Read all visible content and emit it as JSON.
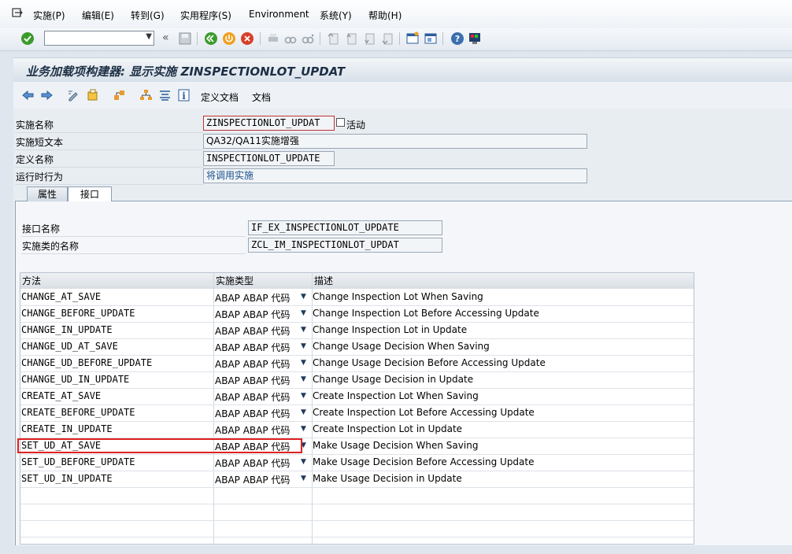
{
  "menu": {
    "items": [
      "实施(P)",
      "编辑(E)",
      "转到(G)",
      "实用程序(S)",
      "Environment",
      "系统(Y)",
      "帮助(H)"
    ]
  },
  "toolbar": {
    "command_value": "",
    "icons": [
      "check-icon",
      "back-double-icon",
      "save-icon",
      "back-icon",
      "exit-icon",
      "cancel-icon",
      "print-icon",
      "find-icon",
      "find-next-icon",
      "first-page-icon",
      "prev-page-icon",
      "next-page-icon",
      "last-page-icon",
      "new-session-icon",
      "shortcut-icon",
      "help-icon",
      "layout-icon"
    ]
  },
  "title": "业务加载项构建器: 显示实施 ZINSPECTIONLOT_UPDAT",
  "app_toolbar": {
    "define_doc": "定义文档",
    "doc": "文档"
  },
  "header_fields": {
    "impl_name_label": "实施名称",
    "impl_name_value": "ZINSPECTIONLOT_UPDAT",
    "active_label": "活动",
    "short_text_label": "实施短文本",
    "short_text_value": "QA32/QA11实施增强",
    "def_name_label": "定义名称",
    "def_name_value": "INSPECTIONLOT_UPDATE",
    "runtime_label": "运行时行为",
    "runtime_value": "将调用实施"
  },
  "tabs": [
    {
      "label": "属性",
      "active": false
    },
    {
      "label": "接口",
      "active": true
    }
  ],
  "interface": {
    "iface_label": "接口名称",
    "iface_value": "IF_EX_INSPECTIONLOT_UPDATE",
    "class_label": "实施类的名称",
    "class_value": "ZCL_IM_INSPECTIONLOT_UPDAT"
  },
  "table": {
    "headers": [
      "方法",
      "实施类型",
      "描述"
    ],
    "rows": [
      {
        "method": "CHANGE_AT_SAVE",
        "type": "ABAP ABAP 代码",
        "desc": "Change Inspection Lot When Saving"
      },
      {
        "method": "CHANGE_BEFORE_UPDATE",
        "type": "ABAP ABAP 代码",
        "desc": "Change Inspection Lot Before Accessing Update"
      },
      {
        "method": "CHANGE_IN_UPDATE",
        "type": "ABAP ABAP 代码",
        "desc": "Change Inspection Lot in Update"
      },
      {
        "method": "CHANGE_UD_AT_SAVE",
        "type": "ABAP ABAP 代码",
        "desc": "Change Usage Decision When Saving"
      },
      {
        "method": "CHANGE_UD_BEFORE_UPDATE",
        "type": "ABAP ABAP 代码",
        "desc": "Change Usage Decision Before Accessing Update"
      },
      {
        "method": "CHANGE_UD_IN_UPDATE",
        "type": "ABAP ABAP 代码",
        "desc": "Change Usage Decision in Update"
      },
      {
        "method": "CREATE_AT_SAVE",
        "type": "ABAP ABAP 代码",
        "desc": "Create Inspection Lot When Saving"
      },
      {
        "method": "CREATE_BEFORE_UPDATE",
        "type": "ABAP ABAP 代码",
        "desc": "Create Inspection Lot Before Accessing Update"
      },
      {
        "method": "CREATE_IN_UPDATE",
        "type": "ABAP ABAP 代码",
        "desc": "Create Inspection Lot in Update"
      },
      {
        "method": "SET_UD_AT_SAVE",
        "type": "ABAP ABAP 代码",
        "desc": "Make Usage Decision When Saving"
      },
      {
        "method": "SET_UD_BEFORE_UPDATE",
        "type": "ABAP ABAP 代码",
        "desc": "Make Usage Decision Before Accessing Update"
      },
      {
        "method": "SET_UD_IN_UPDATE",
        "type": "ABAP ABAP 代码",
        "desc": "Make Usage Decision in Update"
      }
    ],
    "highlight_color": "#e02020"
  }
}
